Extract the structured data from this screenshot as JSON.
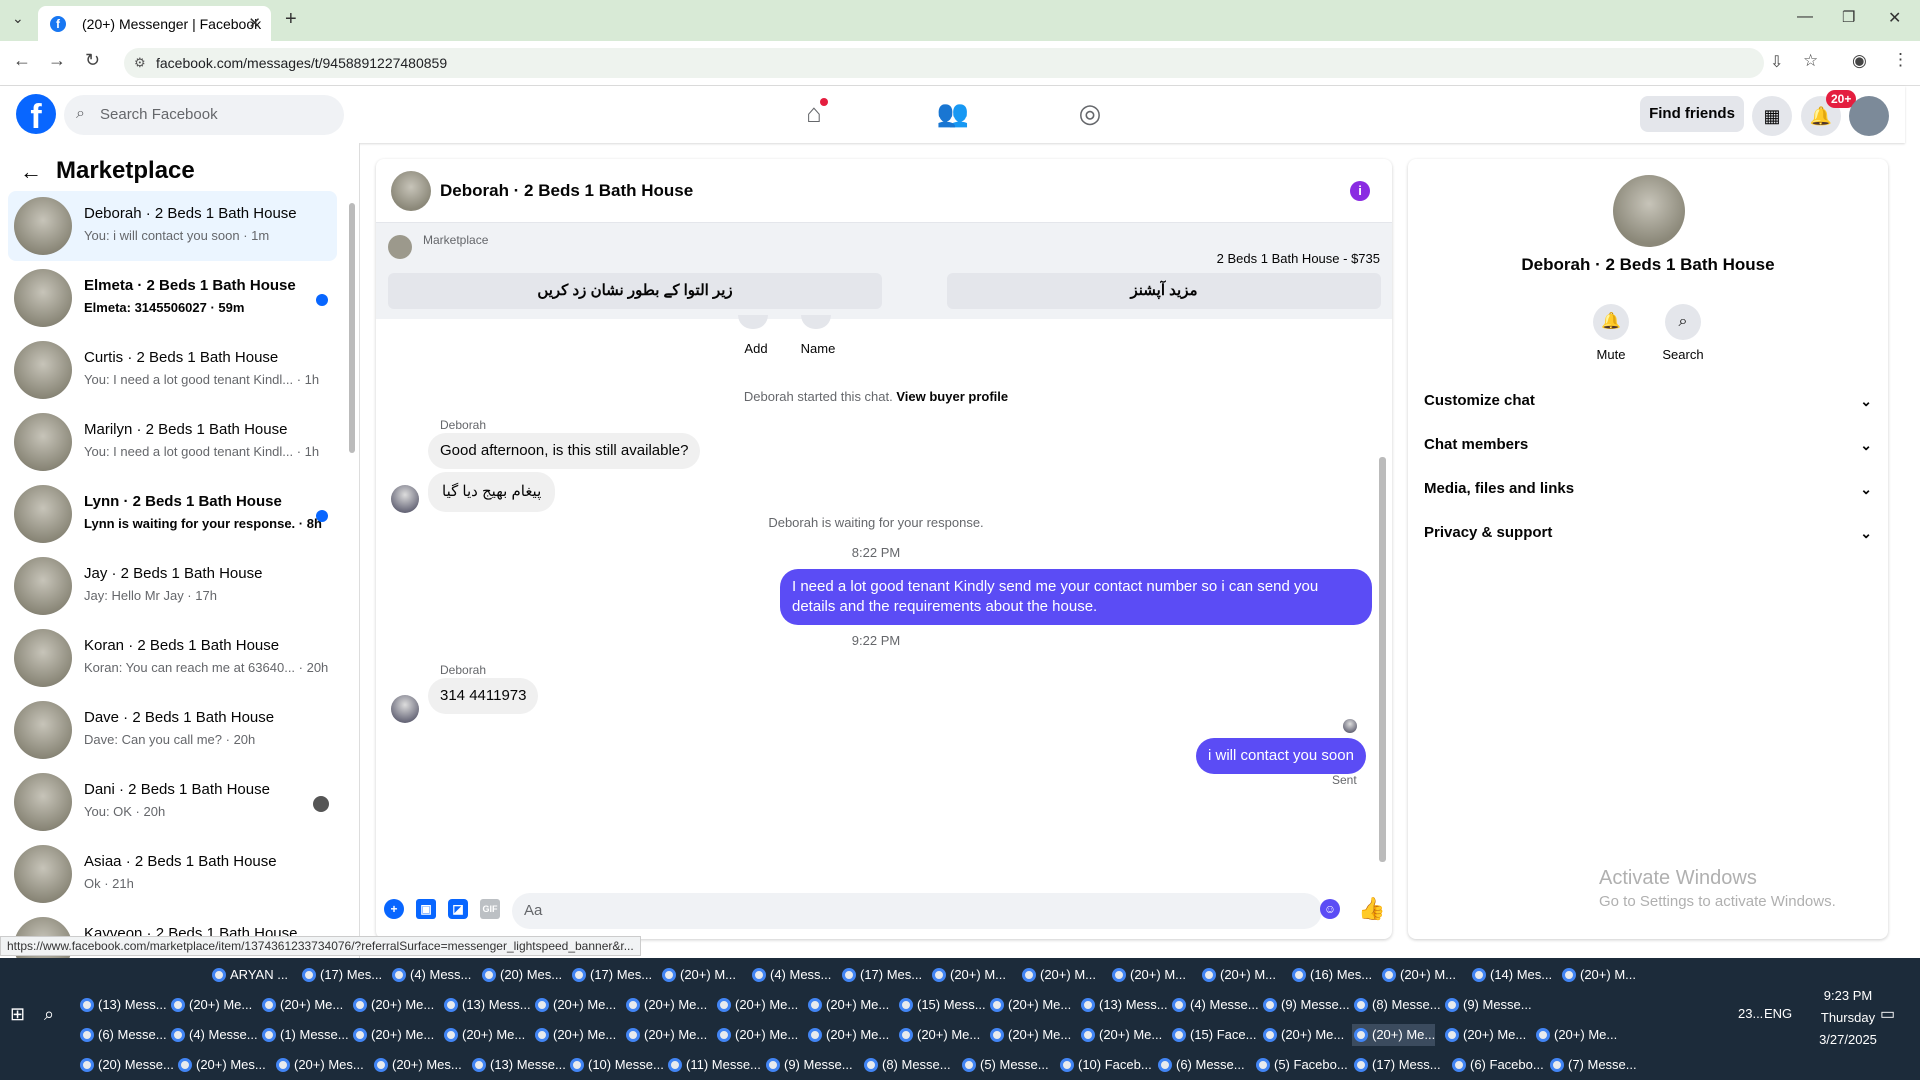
{
  "browser": {
    "tab_title": "(20+) Messenger | Facebook",
    "url": "facebook.com/messages/t/9458891227480859",
    "favicon": "f"
  },
  "header": {
    "search_placeholder": "Search Facebook",
    "find_friends": "Find friends",
    "notif_count": "20+",
    "logo": "f"
  },
  "sidebar": {
    "title": "Marketplace",
    "items": [
      {
        "name": "Deborah · 2 Beds 1 Bath House",
        "snippet": "You: i will contact you soon · 1m",
        "unread": false,
        "active": true
      },
      {
        "name": "Elmeta · 2 Beds 1 Bath House",
        "snippet": "Elmeta: 3145506027 · 59m",
        "unread": true
      },
      {
        "name": "Curtis · 2 Beds 1 Bath House",
        "snippet": "You: I need a lot good tenant Kindl... · 1h",
        "unread": false
      },
      {
        "name": "Marilyn · 2 Beds 1 Bath House",
        "snippet": "You: I need a lot good tenant Kindl... · 1h",
        "unread": false
      },
      {
        "name": "Lynn · 2 Beds 1 Bath House",
        "snippet": "Lynn is waiting for your response. · 8h",
        "unread": true
      },
      {
        "name": "Jay · 2 Beds 1 Bath House",
        "snippet": "Jay: Hello Mr Jay · 17h",
        "unread": false
      },
      {
        "name": "Koran · 2 Beds 1 Bath House",
        "snippet": "Koran: You can reach me at 63640... · 20h",
        "unread": false
      },
      {
        "name": "Dave · 2 Beds 1 Bath House",
        "snippet": "Dave: Can you call me? · 20h",
        "unread": false
      },
      {
        "name": "Dani · 2 Beds 1 Bath House",
        "snippet": "You: OK · 20h",
        "unread": false
      },
      {
        "name": "Asiaa · 2 Beds 1 Bath House",
        "snippet": "Ok · 21h",
        "unread": false
      },
      {
        "name": "Kayveon · 2 Beds 1 Bath House",
        "snippet": "",
        "unread": false
      }
    ]
  },
  "chat": {
    "title": "Deborah · 2 Beds 1 Bath House",
    "marketplace_label": "Marketplace",
    "listing": "2 Beds 1 Bath House - $735",
    "btn_left": "زیر التوا کے بطور نشان زد کریں",
    "btn_right": "مزید آپشنز",
    "add_label": "Add",
    "name_label": "Name",
    "started_text": "Deborah started this chat.",
    "view_profile": "View buyer profile",
    "sender": "Deborah",
    "msg1": "Good afternoon, is this still available?",
    "msg2": "پیغام بھیج دیا گیا",
    "waiting": "Deborah is waiting for your response.",
    "time1": "8:22 PM",
    "msg3": "I need a lot good tenant Kindly send me your contact number so i can send you details and the requirements about the house.",
    "time2": "9:22 PM",
    "msg4": "314 4411973",
    "msg5": "i will contact you soon",
    "sent": "Sent",
    "composer_placeholder": "Aa"
  },
  "rpanel": {
    "name": "Deborah · 2 Beds 1 Bath House",
    "mute": "Mute",
    "search": "Search",
    "rows": [
      "Customize chat",
      "Chat members",
      "Media, files and links",
      "Privacy & support"
    ]
  },
  "activate": {
    "title": "Activate Windows",
    "sub": "Go to Settings to activate Windows."
  },
  "statusbar": "https://www.facebook.com/marketplace/item/1374361233734076/?referralSurface=messenger_lightspeed_banner&r...",
  "taskbar": {
    "row1": [
      "ARYAN ...",
      "(17) Mes...",
      "(4) Mess...",
      "(20) Mes...",
      "(17) Mes...",
      "(20+) M...",
      "(4) Mess...",
      "(17) Mes...",
      "(20+) M...",
      "(20+) M...",
      "(20+) M...",
      "(20+) M...",
      "(16) Mes...",
      "(20+) M...",
      "(14) Mes...",
      "(20+) M..."
    ],
    "row2": [
      "(13) Mess...",
      "(20+) Me...",
      "(20+) Me...",
      "(20+) Me...",
      "(13) Mess...",
      "(20+) Me...",
      "(20+) Me...",
      "(20+) Me...",
      "(20+) Me...",
      "(15) Mess...",
      "(20+) Me...",
      "(13) Mess...",
      "(4) Messe...",
      "(9) Messe...",
      "(8) Messe...",
      "(9) Messe..."
    ],
    "row3": [
      "(6) Messe...",
      "(4) Messe...",
      "(1) Messe...",
      "(20+) Me...",
      "(20+) Me...",
      "(20+) Me...",
      "(20+) Me...",
      "(20+) Me...",
      "(20+) Me...",
      "(20+) Me...",
      "(20+) Me...",
      "(20+) Me...",
      "(15) Face...",
      "(20+) Me...",
      "(20+) Me...",
      "(20+) Me...",
      "(20+) Me..."
    ],
    "row4": [
      "(20) Messe...",
      "(20+) Mes...",
      "(20+) Mes...",
      "(20+) Mes...",
      "(13) Messe...",
      "(10) Messe...",
      "(11) Messe...",
      "(9) Messe...",
      "(8) Messe...",
      "(5) Messe...",
      "(10) Faceb...",
      "(6) Messe...",
      "(5) Facebo...",
      "(17) Mess...",
      "(6) Facebo...",
      "(7) Messe..."
    ],
    "temp": "23...",
    "lang": "ENG",
    "time": "9:23 PM",
    "day": "Thursday",
    "date": "3/27/2025"
  }
}
